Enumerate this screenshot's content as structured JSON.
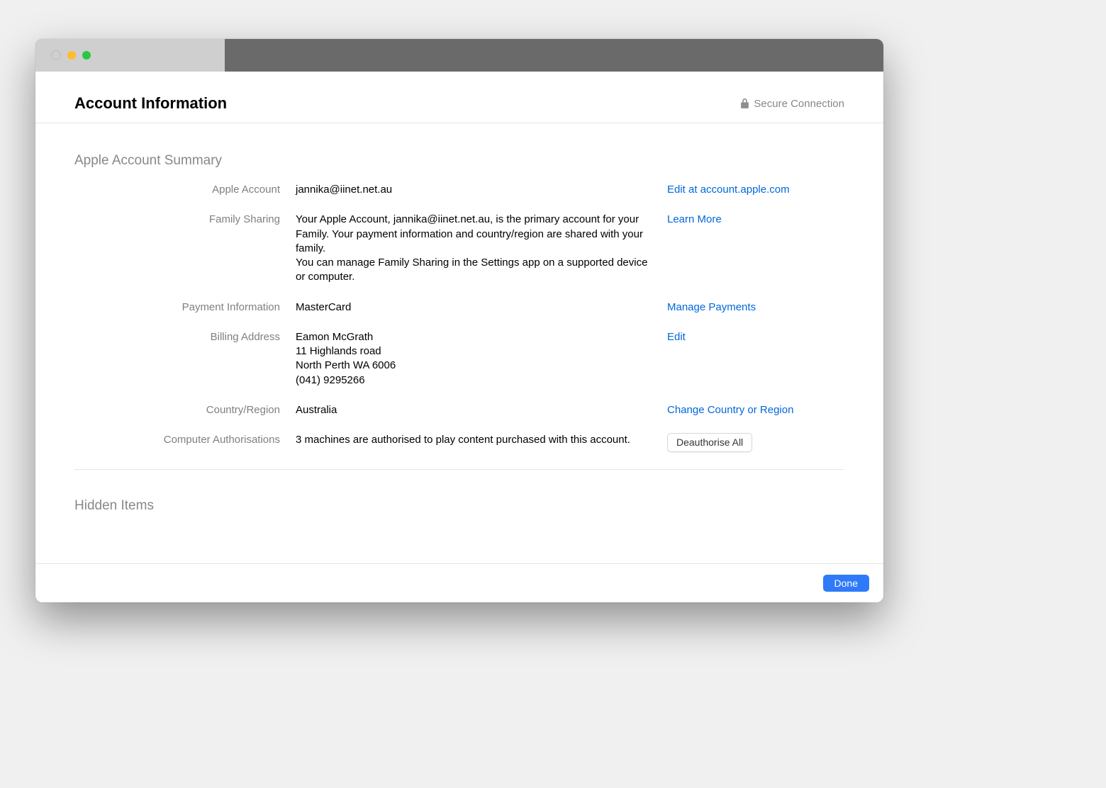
{
  "header": {
    "title": "Account Information",
    "secure_label": "Secure Connection"
  },
  "sections": {
    "summary_title": "Apple Account Summary",
    "hidden_title": "Hidden Items"
  },
  "account": {
    "apple_account_label": "Apple Account",
    "apple_account_value": "jannika@iinet.net.au",
    "apple_account_action": "Edit at account.apple.com",
    "family_sharing_label": "Family Sharing",
    "family_sharing_value_1": "Your Apple Account, jannika@iinet.net.au, is the primary account for your Family. Your payment information and country/region are shared with your family.",
    "family_sharing_value_2": "You can manage Family Sharing in the Settings app on a supported device or computer.",
    "family_sharing_action": "Learn More",
    "payment_label": "Payment Information",
    "payment_value": "MasterCard",
    "payment_action": "Manage Payments",
    "billing_label": "Billing Address",
    "billing_name": "Eamon McGrath",
    "billing_street": "11 Highlands road",
    "billing_city": "North Perth WA 6006",
    "billing_phone": "(041) 9295266",
    "billing_action": "Edit",
    "country_label": "Country/Region",
    "country_value": "Australia",
    "country_action": "Change Country or Region",
    "auth_label": "Computer Authorisations",
    "auth_value": "3 machines are authorised to play content purchased with this account.",
    "auth_action": "Deauthorise All"
  },
  "footer": {
    "done": "Done"
  }
}
